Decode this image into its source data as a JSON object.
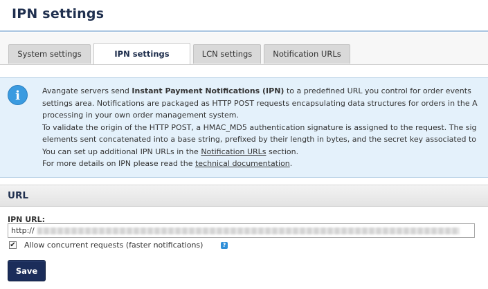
{
  "page": {
    "title": "IPN settings"
  },
  "tabs": [
    {
      "label": "System settings",
      "active": false
    },
    {
      "label": "IPN settings",
      "active": true
    },
    {
      "label": "LCN settings",
      "active": false
    },
    {
      "label": "Notification URLs",
      "active": false
    }
  ],
  "info": {
    "icon": "info-icon",
    "line1_pre": "Avangate servers send ",
    "line1_bold": "Instant Payment Notifications (IPN)",
    "line1_post": " to a predefined URL you control for order events",
    "line2": "settings area. Notifications are packaged as HTTP POST requests encapsulating data structures for orders in the A",
    "line3": "processing in your own order management system.",
    "line4": "To validate the origin of the HTTP POST, a HMAC_MD5 authentication signature is assigned to the request. The sig",
    "line5": "elements sent concatenated into a base string, prefixed by their length in bytes, and the secret key associated to",
    "line6_pre": "You can set up additional IPN URLs in the ",
    "line6_link": "Notification URLs",
    "line6_post": " section.",
    "line7_pre": "For more details on IPN please read the ",
    "line7_link": "technical documentation",
    "line7_post": "."
  },
  "url_section": {
    "title": "URL",
    "ipn_label": "IPN URL:",
    "ipn_value_prefix": "http://",
    "concurrent_label": "Allow concurrent requests (faster notifications)",
    "concurrent_checked": true,
    "help_icon": "question-icon",
    "save_label": "Save"
  },
  "colors": {
    "accent": "#1b2d5a",
    "info_bg": "#e4f1fb",
    "info_icon": "#3a9be0"
  }
}
